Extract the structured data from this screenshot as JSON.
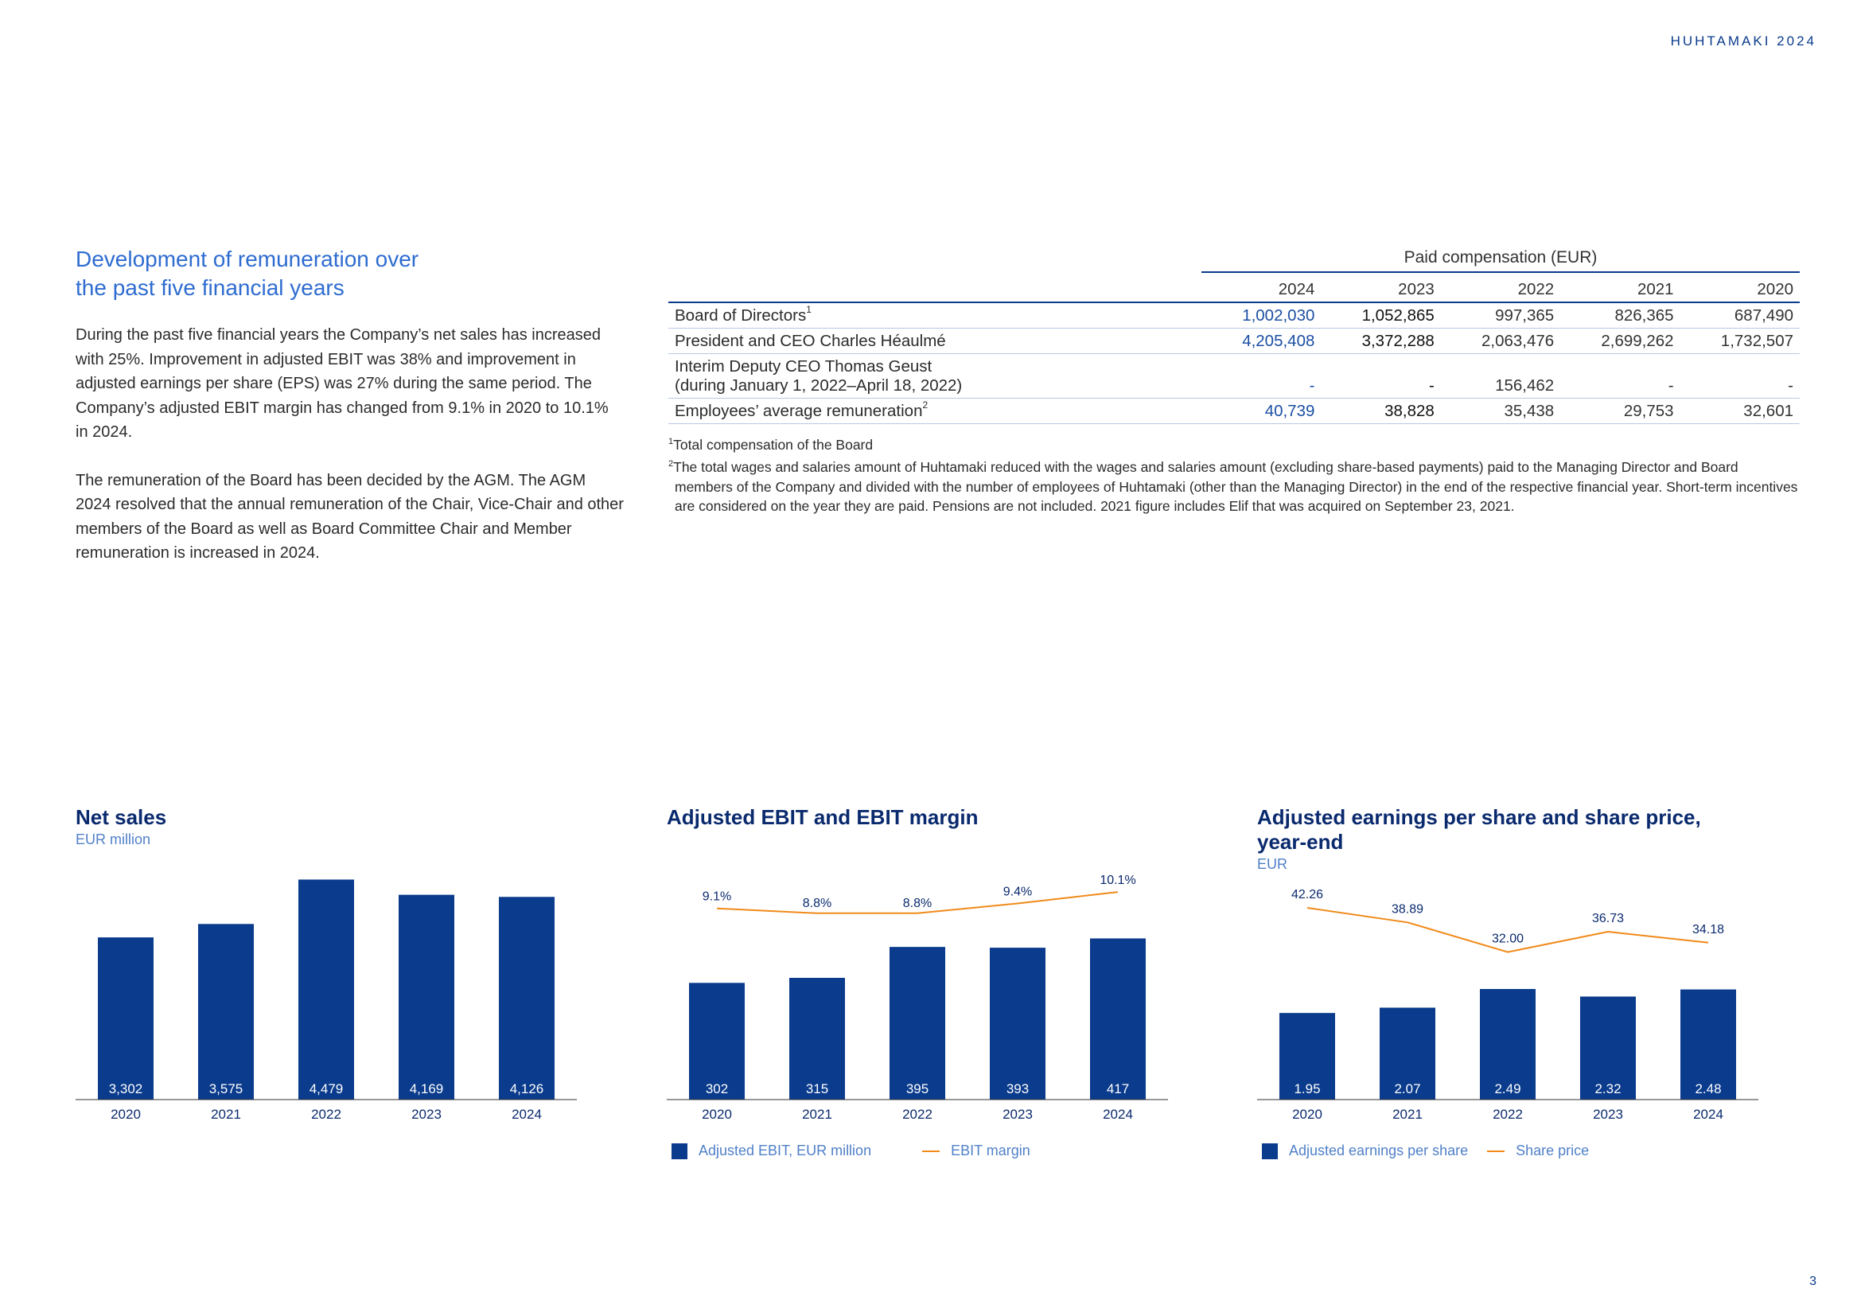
{
  "header": {
    "brand": "HUHTAMAKI 2024",
    "page_number": "3"
  },
  "intro": {
    "title_line1": "Development of remuneration over",
    "title_line2": "the past five financial years",
    "paragraph1": "During the past five financial years the Company’s net sales has increased with 25%. Improvement in adjusted EBIT was 38% and improvement in adjusted earnings per share (EPS) was 27% during the same period. The Company’s adjusted EBIT margin has changed from 9.1% in 2020 to 10.1% in 2024.",
    "paragraph2": "The remuneration of the Board has been decided by the AGM. The AGM 2024 resolved that the annual remuneration of the Chair, Vice-Chair and other members of the Board as well as Board Committee Chair and Member remuneration is increased in 2024."
  },
  "table": {
    "caption": "Paid compensation (EUR)",
    "columns": [
      "2024",
      "2023",
      "2022",
      "2021",
      "2020"
    ],
    "rows": [
      {
        "label": "Board of Directors",
        "sup": "1",
        "values": [
          "1,002,030",
          "1,052,865",
          "997,365",
          "826,365",
          "687,490"
        ]
      },
      {
        "label": "President and CEO Charles Héaulmé",
        "sup": "",
        "values": [
          "4,205,408",
          "3,372,288",
          "2,063,476",
          "2,699,262",
          "1,732,507"
        ]
      },
      {
        "label": "Interim Deputy CEO Thomas Geust",
        "label2": "(during January 1, 2022–April 18, 2022)",
        "sup": "",
        "values": [
          "-",
          "-",
          "156,462",
          "-",
          "-"
        ]
      },
      {
        "label": "Employees’ average remuneration",
        "sup": "2",
        "values": [
          "40,739",
          "38,828",
          "35,438",
          "29,753",
          "32,601"
        ]
      }
    ],
    "note1_marker": "1",
    "note1": "Total compensation of the Board",
    "note2_marker": "2",
    "note2": "The total wages and salaries amount of Huhtamaki reduced with the wages and salaries amount (excluding share-based payments) paid to the Managing Director and Board members of the Company and divided with the number of employees of Huhtamaki (other than the Managing Director) in the end of the respective financial year. Short-term incentives are considered on the year they are paid. Pensions are not included. 2021 figure includes Elif that was acquired on September 23, 2021."
  },
  "colors": {
    "bar": "#0a3b8c",
    "line": "#f08a1a",
    "heading": "#2e6cd0",
    "unit": "#5080c8"
  },
  "chart_data": [
    {
      "type": "bar",
      "title": "Net sales",
      "subtitle": "EUR million",
      "categories": [
        "2020",
        "2021",
        "2022",
        "2023",
        "2024"
      ],
      "values": [
        3302,
        3575,
        4479,
        4169,
        4126
      ],
      "labels": [
        "3,302",
        "3,575",
        "4,479",
        "4,169",
        "4,126"
      ],
      "ylim": [
        0,
        4600
      ]
    },
    {
      "type": "bar",
      "title": "Adjusted EBIT and EBIT margin",
      "categories": [
        "2020",
        "2021",
        "2022",
        "2023",
        "2024"
      ],
      "series": [
        {
          "name": "Adjusted EBIT, EUR million",
          "type": "bar",
          "values": [
            302,
            315,
            395,
            393,
            417
          ],
          "labels": [
            "302",
            "315",
            "395",
            "393",
            "417"
          ]
        },
        {
          "name": "EBIT margin",
          "type": "line",
          "values": [
            9.1,
            8.8,
            8.8,
            9.4,
            10.1
          ],
          "labels": [
            "9.1%",
            "8.8%",
            "8.8%",
            "9.4%",
            "10.1%"
          ]
        }
      ],
      "bar_ylim": [
        0,
        560
      ],
      "line_ylim": [
        0,
        12
      ]
    },
    {
      "type": "bar",
      "title": "Adjusted earnings per share and share price, year-end",
      "subtitle": "EUR",
      "categories": [
        "2020",
        "2021",
        "2022",
        "2023",
        "2024"
      ],
      "series": [
        {
          "name": "Adjusted earnings per share",
          "type": "bar",
          "values": [
            1.95,
            2.07,
            2.49,
            2.32,
            2.48
          ],
          "labels": [
            "1.95",
            "2.07",
            "2.49",
            "2.32",
            "2.48"
          ]
        },
        {
          "name": "Share price",
          "type": "line",
          "values": [
            42.26,
            38.89,
            32.0,
            36.73,
            34.18
          ],
          "labels": [
            "42.26",
            "38.89",
            "32.00",
            "36.73",
            "34.18"
          ]
        }
      ],
      "bar_ylim": [
        0,
        4.3
      ],
      "line_ylim": [
        0,
        48
      ]
    }
  ]
}
